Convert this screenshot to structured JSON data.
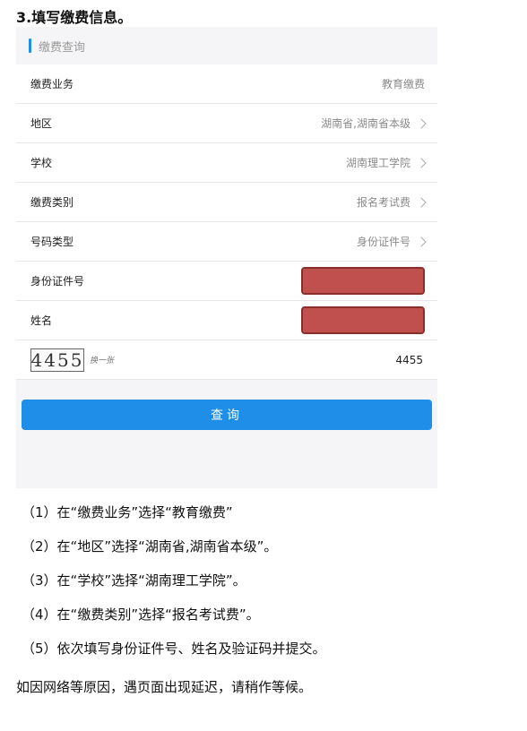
{
  "heading": "3.填写缴费信息。",
  "panel": {
    "title": "缴费查询",
    "rows": [
      {
        "label": "缴费业务",
        "value": "教育缴费"
      },
      {
        "label": "地区",
        "value": "湖南省,湖南省本级"
      },
      {
        "label": "学校",
        "value": "湖南理工学院"
      },
      {
        "label": "缴费类别",
        "value": "报名考试费"
      },
      {
        "label": "号码类型",
        "value": "身份证件号"
      },
      {
        "label": "身份证件号"
      },
      {
        "label": "姓名"
      }
    ],
    "captcha": {
      "image_text": "4455",
      "refresh_text": "换一张",
      "input_value": "4455"
    },
    "submit_label": "查询"
  },
  "steps": [
    "（1）在“缴费业务”选择“教育缴费”",
    "（2）在“地区”选择“湖南省,湖南省本级”。",
    "（3）在“学校”选择“湖南理工学院”。",
    "（4）在“缴费类别”选择“报名考试费”。",
    "（5）依次填写身份证件号、姓名及验证码并提交。"
  ],
  "note": "如因网络等原因，遇页面出现延迟，请稍作等候。",
  "colors": {
    "accent": "#1e8ee8",
    "redaction": "#c0504d"
  }
}
